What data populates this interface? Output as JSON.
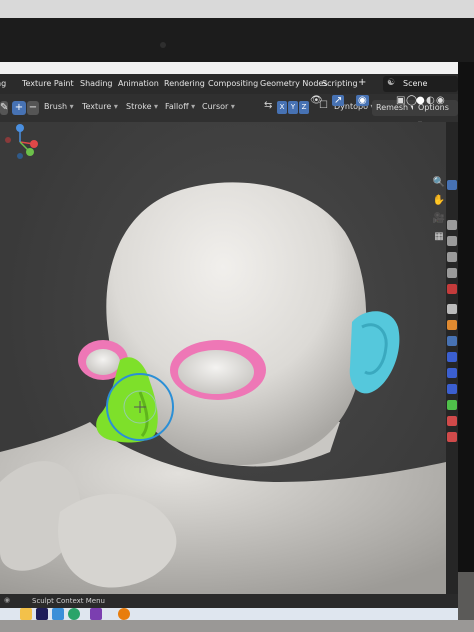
{
  "menu": {
    "tabs": [
      "Texture Paint",
      "Shading",
      "Animation",
      "Rendering",
      "Compositing",
      "Geometry Nodes",
      "Scripting"
    ],
    "add_tab": "+",
    "scene": "Scene"
  },
  "toolbar": {
    "brush": "Brush",
    "texture": "Texture",
    "stroke": "Stroke",
    "falloff": "Falloff",
    "cursor": "Cursor",
    "axes": [
      "X",
      "Y",
      "Z"
    ],
    "dyntopo": "Dyntopo",
    "remesh": "Remesh",
    "options": "Options"
  },
  "statusbar": {
    "text": "Sculpt Context Menu"
  },
  "colors": {
    "head": "#e4e2df",
    "eye_mask": "#ee77b6",
    "nose_mask": "#7ee02a",
    "ear_mask": "#55c8dc",
    "brush_circle": "#2b8fd6",
    "ui_accent": "#4772b3"
  },
  "icons": {
    "viewport_nav": [
      "zoom-icon",
      "pan-hand-icon",
      "camera-view-icon",
      "grid-view-icon"
    ],
    "properties": [
      "tool-icon",
      "render-icon",
      "output-icon",
      "view-layer-icon",
      "scene-icon",
      "world-icon",
      "collection-icon",
      "object-icon",
      "modifier-icon",
      "particles-icon",
      "physics-icon",
      "constraints-icon",
      "data-icon",
      "material-icon",
      "texture-icon"
    ],
    "taskbar": [
      "explorer-icon",
      "after-effects-icon",
      "photos-icon",
      "edge-icon",
      "onenote-icon",
      "blender-icon"
    ]
  }
}
